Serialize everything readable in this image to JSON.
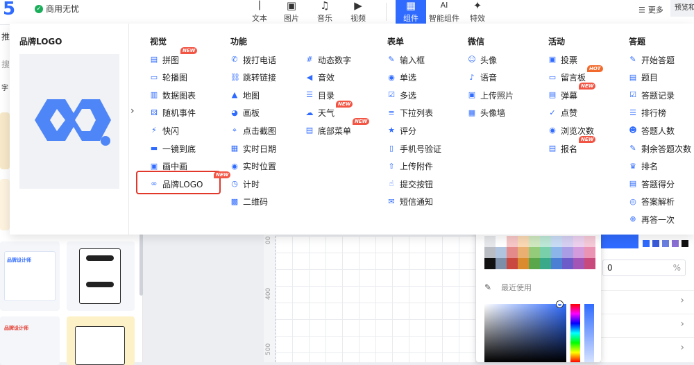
{
  "topbar": {
    "logo": "5",
    "status": "商用无忧",
    "tools": [
      {
        "label": "文本",
        "icon": "text-icon",
        "glyph": "丨"
      },
      {
        "label": "图片",
        "icon": "image-icon",
        "glyph": "▣"
      },
      {
        "label": "音乐",
        "icon": "music-icon",
        "glyph": "♫"
      },
      {
        "label": "视频",
        "icon": "video-icon",
        "glyph": "▶"
      },
      {
        "label": "组件",
        "icon": "component-icon",
        "glyph": "▦",
        "active": true
      },
      {
        "label": "智能组件",
        "icon": "ai-icon",
        "glyph": "AI"
      },
      {
        "label": "特效",
        "icon": "sparkle-icon",
        "glyph": "✦"
      }
    ],
    "more": "更多",
    "preview": "预览和"
  },
  "sidebar": {
    "frag_tab": "推",
    "frag_search": "搜",
    "frag_text": "字",
    "card1_title": "品牌设计师",
    "card2_title": "品牌设计师"
  },
  "canvas": {
    "ruler_400": "400",
    "ruler_500": "500"
  },
  "mega": {
    "brand_title": "品牌LOGO",
    "columns": [
      {
        "title": "视觉",
        "items": [
          {
            "label": "拼图",
            "icon": "puzzle-icon",
            "badge": "NEW"
          },
          {
            "label": "轮播图",
            "icon": "carousel-icon"
          },
          {
            "label": "数据图表",
            "icon": "chart-icon"
          },
          {
            "label": "随机事件",
            "icon": "dice-icon"
          },
          {
            "label": "快闪",
            "icon": "flash-icon"
          },
          {
            "label": "一镜到底",
            "icon": "scroll-shot-icon"
          },
          {
            "label": "画中画",
            "icon": "pip-icon"
          },
          {
            "label": "品牌LOGO",
            "icon": "infinity-icon",
            "badge": "NEW"
          }
        ]
      },
      {
        "title": "功能",
        "items": [
          {
            "label": "拨打电话",
            "icon": "phone-icon"
          },
          {
            "label": "跳转链接",
            "icon": "link-icon"
          },
          {
            "label": "地图",
            "icon": "map-pin-icon"
          },
          {
            "label": "画板",
            "icon": "palette-icon"
          },
          {
            "label": "点击截图",
            "icon": "screenshot-icon"
          },
          {
            "label": "实时日期",
            "icon": "calendar-icon"
          },
          {
            "label": "实时位置",
            "icon": "location-icon"
          },
          {
            "label": "计时",
            "icon": "timer-icon"
          },
          {
            "label": "二维码",
            "icon": "qrcode-icon"
          }
        ]
      },
      {
        "title": "",
        "items": [
          {
            "label": "动态数字",
            "icon": "number-icon"
          },
          {
            "label": "音效",
            "icon": "sound-icon"
          },
          {
            "label": "目录",
            "icon": "catalog-icon"
          },
          {
            "label": "天气",
            "icon": "weather-icon",
            "badge": "NEW"
          },
          {
            "label": "底部菜单",
            "icon": "bottom-menu-icon",
            "badge": "NEW"
          }
        ]
      },
      {
        "title": "表单",
        "items": [
          {
            "label": "输入框",
            "icon": "input-icon"
          },
          {
            "label": "单选",
            "icon": "radio-icon"
          },
          {
            "label": "多选",
            "icon": "checkbox-icon"
          },
          {
            "label": "下拉列表",
            "icon": "dropdown-icon"
          },
          {
            "label": "评分",
            "icon": "star-icon"
          },
          {
            "label": "手机号验证",
            "icon": "mobile-icon"
          },
          {
            "label": "上传附件",
            "icon": "upload-icon"
          },
          {
            "label": "提交按钮",
            "icon": "submit-icon"
          },
          {
            "label": "短信通知",
            "icon": "mail-icon"
          }
        ]
      },
      {
        "title": "微信",
        "items": [
          {
            "label": "头像",
            "icon": "avatar-icon"
          },
          {
            "label": "语音",
            "icon": "mic-icon"
          },
          {
            "label": "上传照片",
            "icon": "photo-icon"
          },
          {
            "label": "头像墙",
            "icon": "avatar-wall-icon"
          }
        ]
      },
      {
        "title": "活动",
        "items": [
          {
            "label": "投票",
            "icon": "vote-icon"
          },
          {
            "label": "留言板",
            "icon": "message-icon",
            "badge": "HOT"
          },
          {
            "label": "弹幕",
            "icon": "danmaku-icon",
            "badge": "NEW"
          },
          {
            "label": "点赞",
            "icon": "thumb-up-icon"
          },
          {
            "label": "浏览次数",
            "icon": "eye-icon"
          },
          {
            "label": "报名",
            "icon": "signup-icon",
            "badge": "NEW"
          }
        ]
      },
      {
        "title": "答题",
        "items": [
          {
            "label": "开始答题",
            "icon": "pen-icon"
          },
          {
            "label": "题目",
            "icon": "question-icon"
          },
          {
            "label": "答题记录",
            "icon": "record-icon"
          },
          {
            "label": "排行榜",
            "icon": "rank-list-icon"
          },
          {
            "label": "答题人数",
            "icon": "people-icon"
          },
          {
            "label": "剩余答题次数",
            "icon": "edit-count-icon"
          },
          {
            "label": "排名",
            "icon": "crown-icon"
          },
          {
            "label": "答题得分",
            "icon": "score-icon"
          },
          {
            "label": "答案解析",
            "icon": "analysis-icon"
          },
          {
            "label": "再答一次",
            "icon": "retry-icon"
          }
        ]
      }
    ]
  },
  "picker": {
    "recent_label": "最近使用"
  },
  "right_panel": {
    "opacity_value": "0",
    "opacity_unit": "%"
  },
  "colors": {
    "accent": "#2f6bff",
    "badge_new": "#f25544",
    "badge_hot": "#f36b2c",
    "highlight": "#e2372b"
  }
}
